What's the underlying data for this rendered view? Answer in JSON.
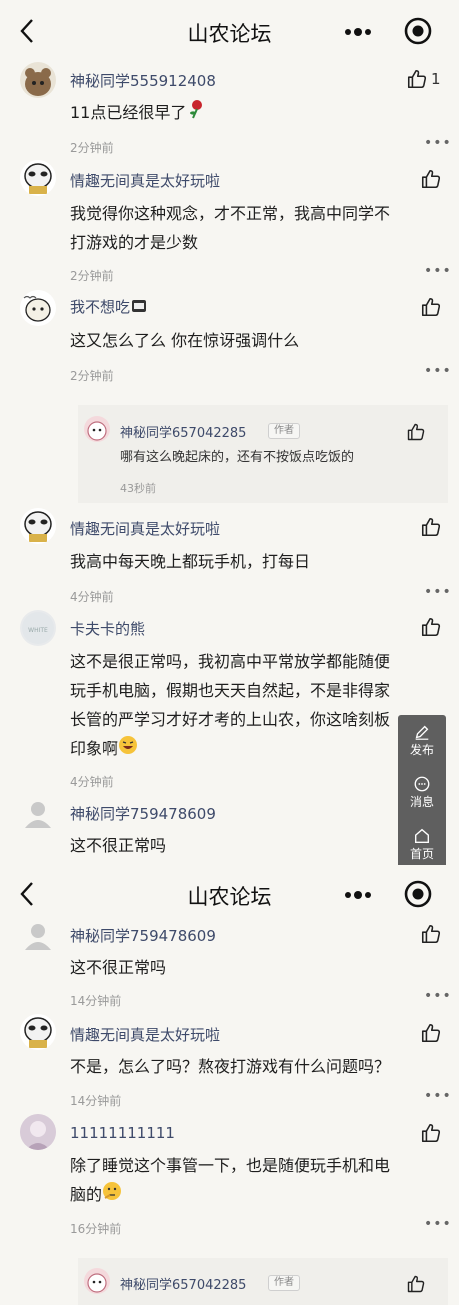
{
  "app": {
    "title": "山农论坛"
  },
  "topbar_more": "•••",
  "comments": [
    {
      "name": "神秘同学555912408",
      "text": [
        "11点已经很早了"
      ],
      "time": "2分钟前",
      "likes": "1"
    },
    {
      "name": "情趣无间真是太好玩啦",
      "text": [
        "我觉得你这种观念，才不正常，我高中同学不",
        "打游戏的才是少数"
      ],
      "time": "2分钟前"
    },
    {
      "name": "我不想吃",
      "text": [
        "这又怎么了么 你在惊讶强调什么"
      ],
      "time": "2分钟前"
    },
    {
      "name": "情趣无间真是太好玩啦",
      "text": [
        "我高中每天晚上都玩手机，打每日"
      ],
      "time": "4分钟前"
    },
    {
      "name": "卡夫卡的熊",
      "text": [
        "这不是很正常吗，我初高中平常放学都能随便",
        "玩手机电脑，假期也天天自然起，不是非得家",
        "长管的严学习才好才考的上山农，你这啥刻板",
        "印象啊"
      ],
      "time": "4分钟前"
    },
    {
      "name": "神秘同学759478609",
      "text": [
        "这不很正常吗"
      ]
    },
    {
      "name": "神秘同学759478609",
      "text": [
        "这不很正常吗"
      ],
      "time": "14分钟前"
    },
    {
      "name": "情趣无间真是太好玩啦",
      "text": [
        "不是，怎么了吗？熬夜打游戏有什么问题吗？"
      ],
      "time": "14分钟前"
    },
    {
      "name": "11111111111",
      "text": [
        "除了睡觉这个事管一下，也是随便玩手机和电",
        "脑的"
      ],
      "time": "16分钟前"
    }
  ],
  "replies": [
    {
      "name": "神秘同学657042285",
      "badge": "作者",
      "text": "哪有这么晚起床的，还有不按饭点吃饭的",
      "time": "43秒前"
    },
    {
      "name": "神秘同学657042285",
      "badge": "作者"
    }
  ],
  "float_menu": {
    "publish": "发布",
    "messages": "消息",
    "home": "首页"
  },
  "colors": {
    "background": "#f7f6f2",
    "name": "#3e4a6a",
    "time": "#9a9a9a",
    "float_bg": "#5f5f5f"
  }
}
